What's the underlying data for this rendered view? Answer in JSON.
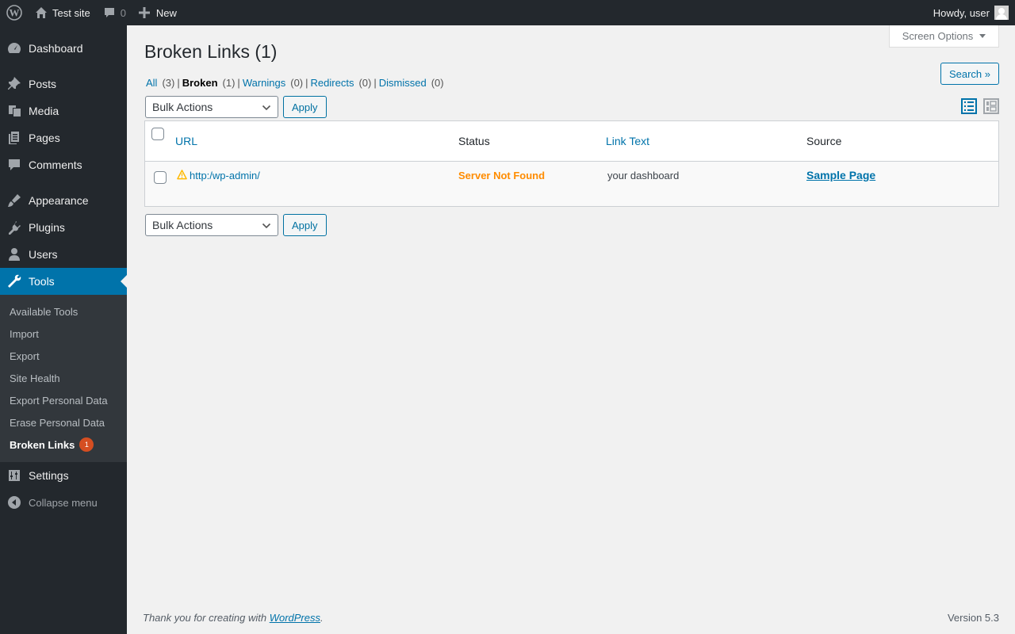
{
  "adminbar": {
    "site_name": "Test site",
    "comments_count": "0",
    "new_label": "New",
    "howdy": "Howdy, user"
  },
  "sidebar": {
    "items": [
      {
        "label": "Dashboard",
        "icon": "dashboard-icon"
      },
      {
        "label": "Posts",
        "icon": "pushpin-icon"
      },
      {
        "label": "Media",
        "icon": "media-icon"
      },
      {
        "label": "Pages",
        "icon": "pages-icon"
      },
      {
        "label": "Comments",
        "icon": "comment-icon"
      },
      {
        "label": "Appearance",
        "icon": "brush-icon"
      },
      {
        "label": "Plugins",
        "icon": "plugin-icon"
      },
      {
        "label": "Users",
        "icon": "user-icon"
      },
      {
        "label": "Tools",
        "icon": "wrench-icon"
      }
    ],
    "submenu": [
      {
        "label": "Available Tools"
      },
      {
        "label": "Import"
      },
      {
        "label": "Export"
      },
      {
        "label": "Site Health"
      },
      {
        "label": "Export Personal Data"
      },
      {
        "label": "Erase Personal Data"
      },
      {
        "label": "Broken Links",
        "badge": "1"
      }
    ],
    "settings": "Settings",
    "collapse": "Collapse menu"
  },
  "main": {
    "screen_options": "Screen Options",
    "title": "Broken Links (1)",
    "filters": [
      {
        "label": "All",
        "count": "(3)"
      },
      {
        "label": "Broken",
        "count": "(1)"
      },
      {
        "label": "Warnings",
        "count": "(0)"
      },
      {
        "label": "Redirects",
        "count": "(0)"
      },
      {
        "label": "Dismissed",
        "count": "(0)"
      }
    ],
    "search_button": "Search »",
    "bulk_actions": "Bulk Actions",
    "apply": "Apply",
    "table": {
      "headers": [
        "URL",
        "Status",
        "Link Text",
        "Source"
      ],
      "rows": [
        {
          "url": "http:/wp-admin/",
          "status": "Server Not Found",
          "link_text": "your dashboard",
          "source": "Sample Page"
        }
      ]
    }
  },
  "footer": {
    "thanks_prefix": "Thank you for creating with ",
    "thanks_link": "WordPress",
    "thanks_suffix": ".",
    "version": "Version 5.3"
  },
  "colors": {
    "accent": "#0073aa",
    "status_error": "#ff8c00",
    "badge": "#d54e21"
  }
}
